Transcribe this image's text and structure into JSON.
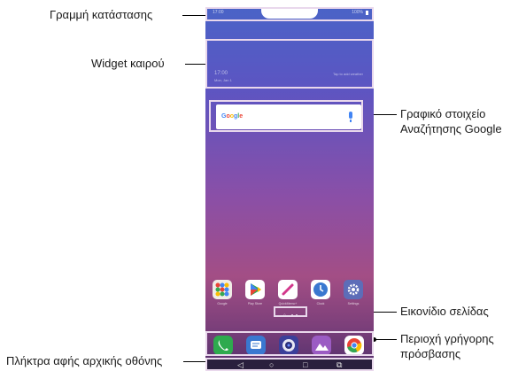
{
  "callouts": {
    "status_bar": "Γραμμή κατάστασης",
    "weather_widget": "Widget καιρού",
    "google_search_line1": "Γραφικό στοιχείο",
    "google_search_line2": "Αναζήτησης Google",
    "page_icon": "Εικονίδιο σελίδας",
    "quick_access_line1": "Περιοχή γρήγορης",
    "quick_access_line2": "πρόσβασης",
    "home_touch_keys": "Πλήκτρα αφής αρχικής οθόνης"
  },
  "phone": {
    "status": {
      "time": "17:00",
      "battery": "100%"
    },
    "weather": {
      "time": "17:00",
      "date": "Mon, Jan 1",
      "tap_hint": "Tap to add weather"
    },
    "search": {
      "logo_parts": [
        "G",
        "o",
        "o",
        "g",
        "l",
        "e"
      ]
    },
    "apps": [
      {
        "label": "Google",
        "icon": "google-folder-icon",
        "color": "#f0ece6"
      },
      {
        "label": "Play Store",
        "icon": "play-store-icon",
        "color": "#ffffff"
      },
      {
        "label": "QuickMemo+",
        "icon": "quickmemo-icon",
        "color": "#ffffff"
      },
      {
        "label": "Clock",
        "icon": "clock-icon",
        "color": "#ffffff"
      },
      {
        "label": "Settings",
        "icon": "settings-icon",
        "color": "#5d6db8"
      }
    ],
    "dock": [
      {
        "icon": "phone-icon",
        "color": "#2eaa4e"
      },
      {
        "icon": "messaging-icon",
        "color": "#3a78d0"
      },
      {
        "icon": "camera-icon",
        "color": "#3b3f9a"
      },
      {
        "icon": "gallery-icon",
        "color": "#9b5cc3"
      },
      {
        "icon": "chrome-icon",
        "color": "#ffffff"
      }
    ],
    "page_indicator": {
      "home_glyph": "⌂",
      "pages": 2
    },
    "navbar": {
      "back": "◁",
      "home": "○",
      "recents": "□",
      "dual": "⧉"
    }
  },
  "colors": {
    "highlight": "#e9d8ec",
    "leader": "#000000"
  }
}
